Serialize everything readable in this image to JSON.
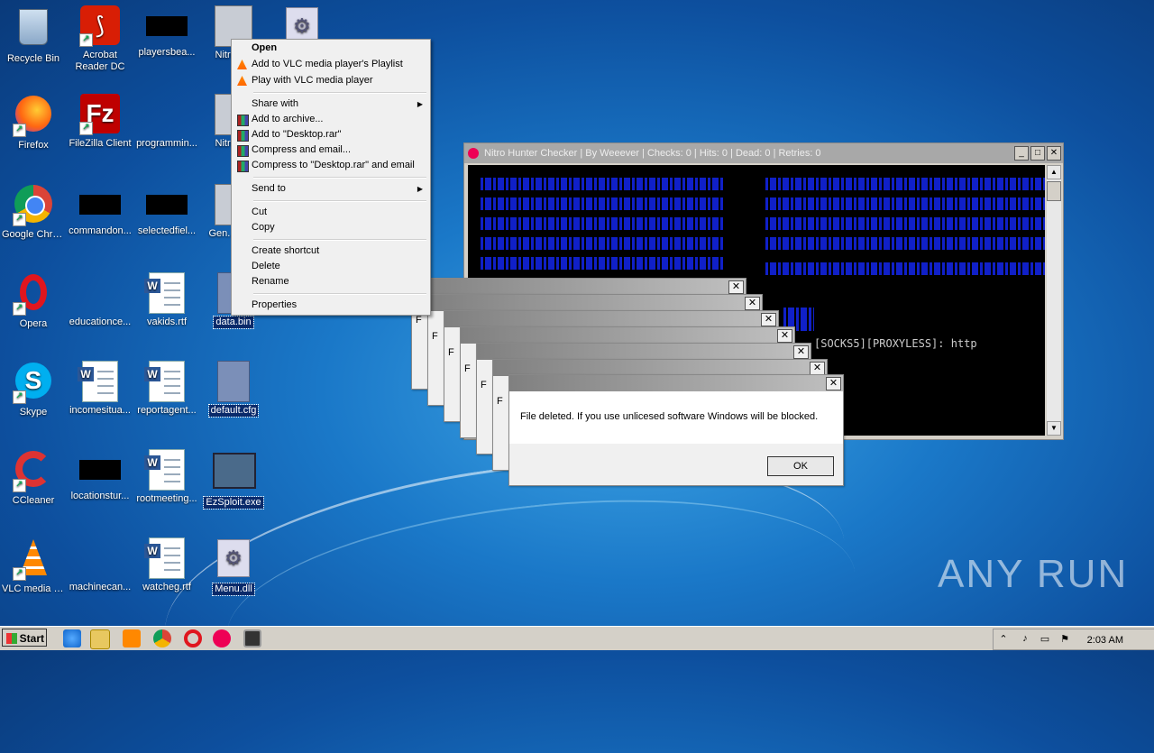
{
  "desktop_icons": [
    {
      "label": "Recycle Bin"
    },
    {
      "label": "Acrobat Reader DC"
    },
    {
      "label": "playersbea..."
    },
    {
      "label": "NitroG..."
    },
    {
      "label": "Firefox"
    },
    {
      "label": "FileZilla Client"
    },
    {
      "label": "programmin..."
    },
    {
      "label": "NitroG..."
    },
    {
      "label": "Google Chrome"
    },
    {
      "label": "commandon..."
    },
    {
      "label": "selectedfiel..."
    },
    {
      "label": "Gen... Sc..."
    },
    {
      "label": "Opera"
    },
    {
      "label": "educationce..."
    },
    {
      "label": "vakids.rtf"
    },
    {
      "label": "data.bin"
    },
    {
      "label": "Skype"
    },
    {
      "label": "incomesitua..."
    },
    {
      "label": "reportagent..."
    },
    {
      "label": "default.cfg"
    },
    {
      "label": "CCleaner"
    },
    {
      "label": "locationstur..."
    },
    {
      "label": "rootmeeting..."
    },
    {
      "label": "EzSploit.exe"
    },
    {
      "label": "VLC media player"
    },
    {
      "label": "machinecan..."
    },
    {
      "label": "watcheg.rtf"
    },
    {
      "label": "Menu.dll"
    }
  ],
  "context_menu": {
    "open": "Open",
    "vlc_playlist": "Add to VLC media player's Playlist",
    "vlc_play": "Play with VLC media player",
    "share_with": "Share with",
    "add_archive": "Add to archive...",
    "add_desktop_rar": "Add to \"Desktop.rar\"",
    "compress_email": "Compress and email...",
    "compress_desktop_email": "Compress to \"Desktop.rar\" and email",
    "send_to": "Send to",
    "cut": "Cut",
    "copy": "Copy",
    "create_shortcut": "Create shortcut",
    "delete": "Delete",
    "rename": "Rename",
    "properties": "Properties"
  },
  "console_window": {
    "title": "Nitro Hunter Checker | By Weeever | Checks: 0 | Hits: 0 | Dead: 0 | Retries: 0",
    "prompt_text": "[SOCKS5][PROXYLESS]: http"
  },
  "message_box": {
    "text": "File deleted. If you use unlicesed software Windows will be blocked.",
    "partial_letter": "F",
    "ok": "OK"
  },
  "taskbar": {
    "start": "Start",
    "clock": "2:03 AM"
  },
  "watermark": "ANY RUN"
}
